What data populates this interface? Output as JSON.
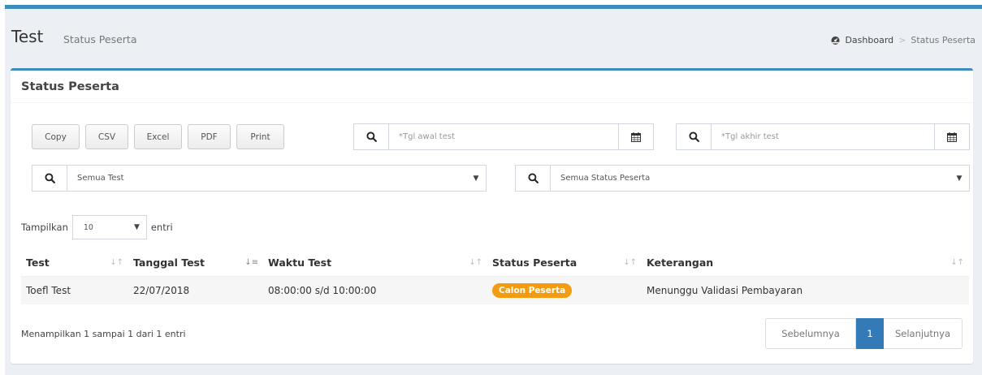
{
  "header": {
    "title": "Test",
    "subtitle": "Status Peserta",
    "breadcrumb": {
      "home": "Dashboard",
      "separator": ">",
      "current": "Status Peserta"
    }
  },
  "box": {
    "title": "Status Peserta",
    "buttons": {
      "copy": "Copy",
      "csv": "CSV",
      "excel": "Excel",
      "pdf": "PDF",
      "print": "Print"
    },
    "filters": {
      "start_date_placeholder": "*Tgl awal test",
      "end_date_placeholder": "*Tgl akhir test",
      "test_select": "Semua Test",
      "status_select": "Semua Status Peserta"
    },
    "length": {
      "label_before": "Tampilkan",
      "value": "10",
      "label_after": "entri"
    },
    "table": {
      "headers": [
        "Test",
        "Tanggal Test",
        "Waktu Test",
        "Status Peserta",
        "Keterangan"
      ],
      "rows": [
        {
          "test": "Toefl Test",
          "date": "22/07/2018",
          "time": "08:00:00 s/d 10:00:00",
          "status": "Calon Peserta",
          "note": "Menunggu Validasi Pembayaran"
        }
      ]
    },
    "info": "Menampilkan 1 sampai 1 dari 1 entri",
    "pagination": {
      "prev": "Sebelumnya",
      "page": "1",
      "next": "Selanjutnya"
    }
  },
  "colors": {
    "primary": "#3c8dbc",
    "badge": "#f39c12",
    "page_active": "#337ab7",
    "background": "#ecf0f5"
  },
  "icons": {
    "search": "search-icon",
    "calendar": "calendar-icon",
    "dashboard": "dashboard-icon",
    "sort": "sort-icon"
  }
}
